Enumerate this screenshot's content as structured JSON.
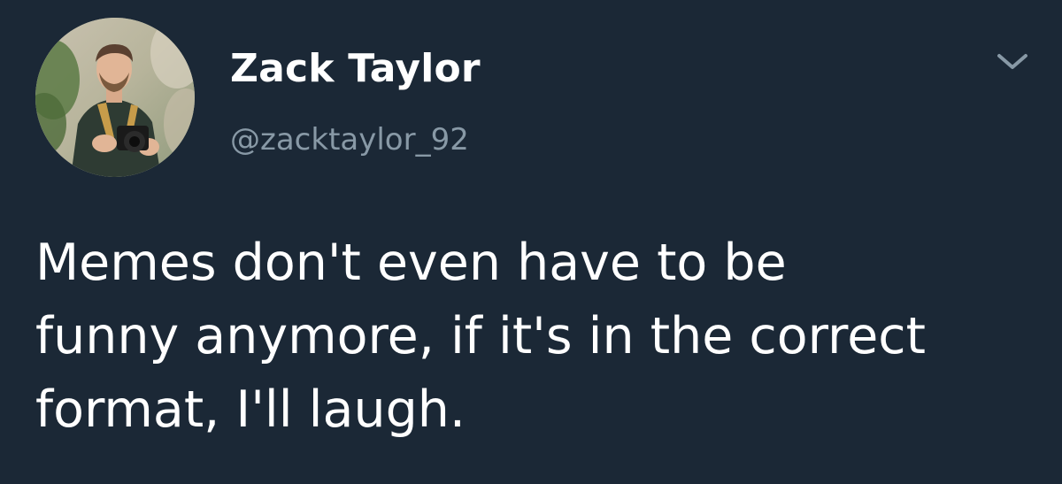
{
  "tweet": {
    "author": {
      "display_name": "Zack Taylor",
      "handle": "@zacktaylor_92",
      "avatar_icon": "user-avatar-photo"
    },
    "text": "Memes don't even have to be\nfunny anymore, if it's in the correct\nformat, I'll laugh.",
    "menu_icon": "chevron-down-icon"
  },
  "colors": {
    "background": "#1b2836",
    "name": "#ffffff",
    "handle": "#8899a6",
    "chevron": "#8899a6"
  }
}
